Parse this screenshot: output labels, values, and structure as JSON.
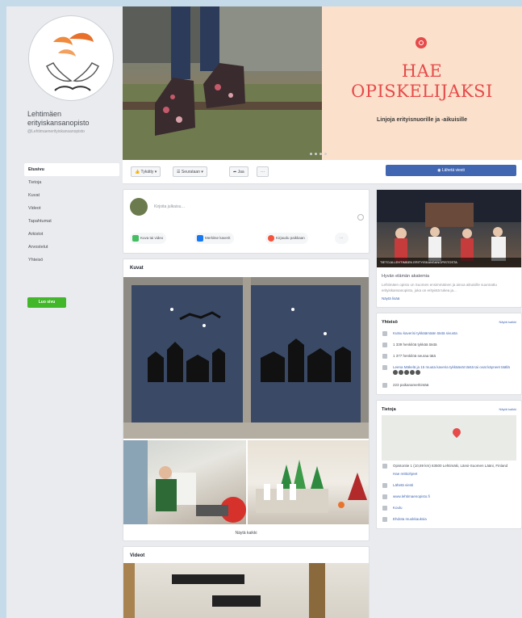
{
  "page": {
    "name": "Lehtimäen erityiskansanopisto",
    "handle": "@Lehtimaenerityiskansanopisto"
  },
  "nav": {
    "items": [
      "Etusivu",
      "Tietoja",
      "Kuvat",
      "Videot",
      "Tapahtumat",
      "Arkistot",
      "Arvostelut",
      "Yhteisö"
    ],
    "active_index": 0,
    "create_label": "Luo sivu"
  },
  "cover": {
    "banner_title_1": "HAE",
    "banner_title_2": "OPISKELIJAKSI",
    "banner_subtitle": "Linjoja erityisnuorille ja -aikuisille"
  },
  "actions": {
    "like": "Tykätty ▾",
    "follow": "Seurataan ▾",
    "share": "Jaa",
    "more": "···",
    "send_message": "Lähetä viesti"
  },
  "composer": {
    "placeholder": "Kirjoita julkaisu…",
    "chip_photo": "Kuva tai video",
    "chip_tag": "Merkitse kaverit",
    "chip_checkin": "Kirjaudu paikkaan",
    "chip_more": "···"
  },
  "photos": {
    "title": "Kuvat",
    "see_all": "Näytä kaikki"
  },
  "videos": {
    "title": "Videot"
  },
  "event": {
    "caption": "TIETOJA LEHTIMÄEN ERITYISKANSANOPISTOSTA"
  },
  "about": {
    "title": "Hyvän elämän akatemia",
    "text": "Lehtimäen opisto on Suomen ensimmäinen ja ainoa aikuisille suunnattu erityiskansanopisto, joka on erityistä tukea ja...",
    "more": "Näytä lisää"
  },
  "community": {
    "title": "Yhteisö",
    "see_all": "Näytä kaikki",
    "rows": [
      "Kutsu kaverisi tykkäämään tästä sivusta",
      "1 339 henkilöä tykkää tästä",
      "1 377 henkilöä seuraa tätä",
      "Leena Mäkelä ja 15 muuta kaveria tykkäävät tästä tai ovat käyneet täällä",
      "223 paikanamerkintää"
    ]
  },
  "info": {
    "title": "Tietoja",
    "see_all": "Näytä kaikki",
    "rows": [
      "Opistontie 1 (10,69 km) 63500 Lehtimäki, Länsi-Suomen Lääni, Finland",
      "Hae reittiohjeet",
      "Lähetä viesti",
      "www.lehtimaenopisto.fi",
      "Koulu",
      "Ehdota muokkauksia"
    ]
  },
  "colors": {
    "brand_blue": "#4267b2",
    "banner_red": "#e64a4a",
    "banner_bg": "#fbe0cb",
    "create_green": "#42b72a"
  }
}
